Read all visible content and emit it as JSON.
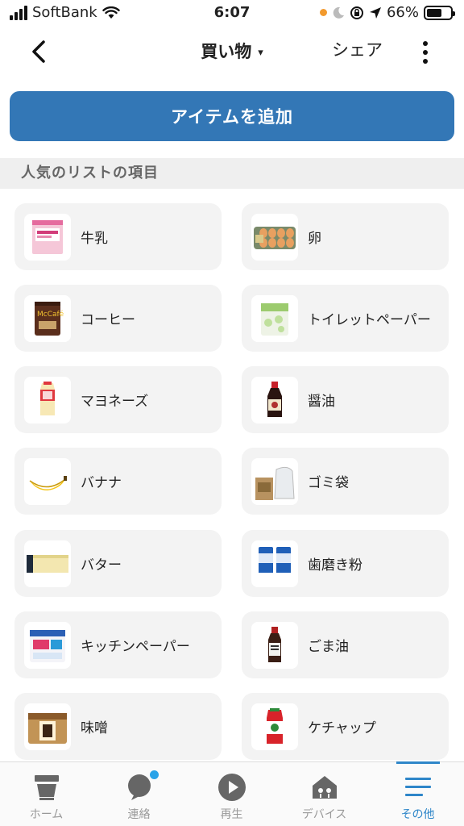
{
  "status_bar": {
    "carrier": "SoftBank",
    "time": "6:07",
    "battery_text": "66%",
    "battery_level": 0.66
  },
  "nav": {
    "title": "買い物",
    "caret": "▾",
    "share_label": "シェア"
  },
  "add_button_label": "アイテムを追加",
  "section_title": "人気のリストの項目",
  "items": [
    {
      "label": "牛乳",
      "icon": "milk-carton-icon"
    },
    {
      "label": "卵",
      "icon": "egg-carton-icon"
    },
    {
      "label": "コーヒー",
      "icon": "coffee-can-icon"
    },
    {
      "label": "トイレットペーパー",
      "icon": "toilet-paper-icon"
    },
    {
      "label": "マヨネーズ",
      "icon": "mayonnaise-icon"
    },
    {
      "label": "醤油",
      "icon": "soy-sauce-icon"
    },
    {
      "label": "バナナ",
      "icon": "banana-icon"
    },
    {
      "label": "ゴミ袋",
      "icon": "trash-bag-icon"
    },
    {
      "label": "バター",
      "icon": "butter-icon"
    },
    {
      "label": "歯磨き粉",
      "icon": "toothpaste-icon"
    },
    {
      "label": "キッチンペーパー",
      "icon": "kitchen-paper-icon"
    },
    {
      "label": "ごま油",
      "icon": "sesame-oil-icon"
    },
    {
      "label": "味噌",
      "icon": "miso-icon"
    },
    {
      "label": "ケチャップ",
      "icon": "ketchup-icon"
    }
  ],
  "tabs": [
    {
      "label": "ホーム",
      "icon": "home-icon"
    },
    {
      "label": "連絡",
      "icon": "chat-icon"
    },
    {
      "label": "再生",
      "icon": "play-icon"
    },
    {
      "label": "デバイス",
      "icon": "devices-icon"
    },
    {
      "label": "その他",
      "icon": "menu-icon",
      "active": true
    }
  ],
  "colors": {
    "accent": "#3377b6",
    "tab_active": "#2e86c9",
    "card_bg": "#f3f3f3",
    "section_bg": "#efefef"
  }
}
